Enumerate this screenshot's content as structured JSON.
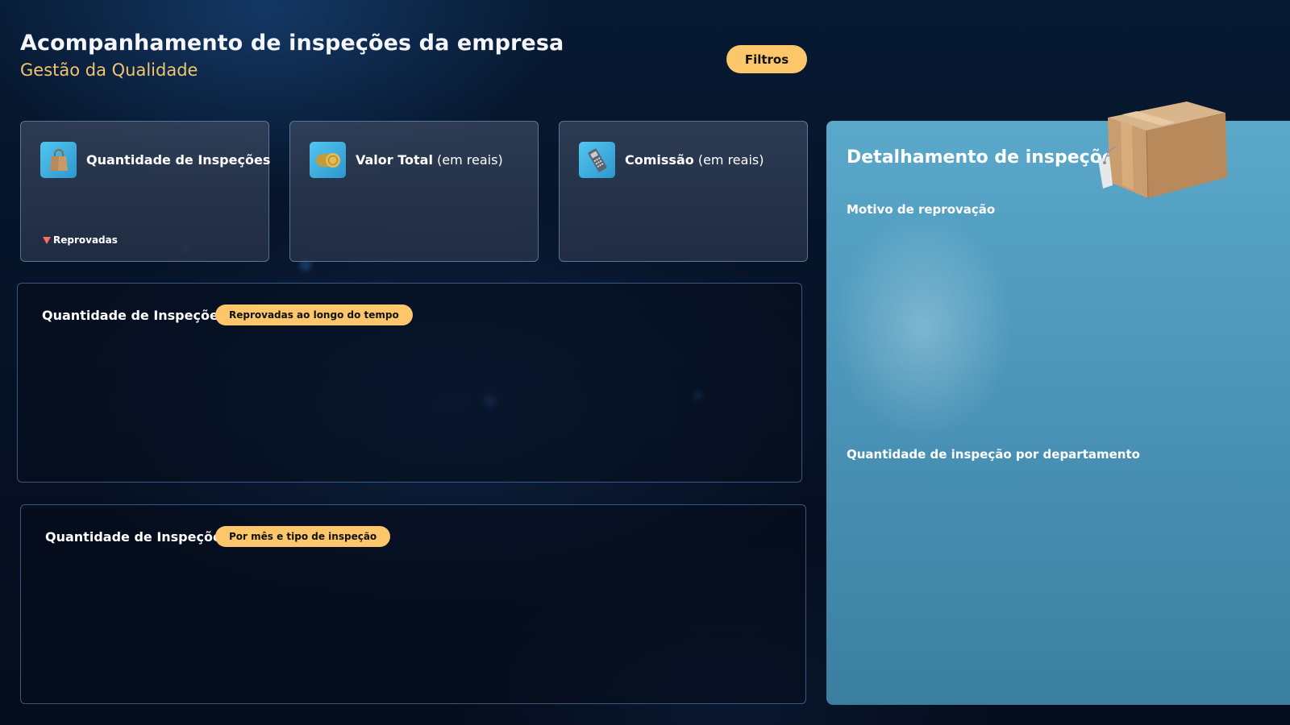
{
  "header": {
    "title": "Acompanhamento de inspeções da empresa",
    "subtitle": "Gestão da Qualidade",
    "filter_label": "Filtros"
  },
  "kpis": [
    {
      "title": "Quantidade de Inspeções",
      "suffix": "",
      "icon": "shopping-bag-icon",
      "delta_label": "Reprovadas",
      "delta_direction": "down"
    },
    {
      "title": "Valor Total",
      "suffix": " (em reais)",
      "icon": "coins-icon"
    },
    {
      "title": "Comissão",
      "suffix": " (em reais)",
      "icon": "card-machine-icon"
    }
  ],
  "panels": [
    {
      "title": "Quantidade de Inspeções",
      "badge": "Reprovadas ao longo do tempo"
    },
    {
      "title": "Quantidade de Inspeções",
      "badge": "Por mês e tipo de inspeção"
    }
  ],
  "side": {
    "title": "Detalhamento de inspeções",
    "section1": "Motivo de reprovação",
    "section2": "Quantidade de inspeção por departamento",
    "illustration": "cardboard-box-icon"
  },
  "colors": {
    "accent": "#fcc66a",
    "subtitle": "#f3c46f",
    "side_panel": "#4a93b7",
    "icon_bg": "#3fb2e2",
    "negative": "#ff6b6b"
  }
}
